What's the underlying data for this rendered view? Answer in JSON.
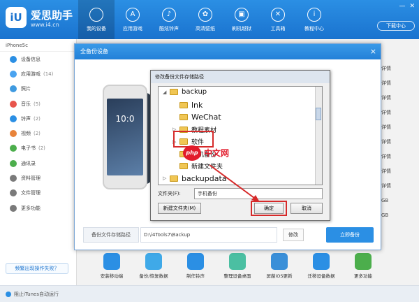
{
  "app": {
    "logo_text": "iU",
    "brand": "爱思助手",
    "url": "www.i4.cn",
    "download_center": "下载中心"
  },
  "nav": [
    {
      "label": "我的设备",
      "icon": "apple-icon"
    },
    {
      "label": "应用游戏",
      "icon": "appstore-icon"
    },
    {
      "label": "酷炫铃声",
      "icon": "bell-icon"
    },
    {
      "label": "高清壁纸",
      "icon": "flower-icon"
    },
    {
      "label": "刷机越狱",
      "icon": "box-icon"
    },
    {
      "label": "工具箱",
      "icon": "tools-icon"
    },
    {
      "label": "教程中心",
      "icon": "info-icon"
    }
  ],
  "sidebar": {
    "device": "iPhone5c",
    "items": [
      {
        "label": "设备信息",
        "count": "",
        "color": "#2b8fe4"
      },
      {
        "label": "应用游戏",
        "count": "(14)",
        "color": "#4aa3f0"
      },
      {
        "label": "照片",
        "count": "",
        "color": "#3f9ae0"
      },
      {
        "label": "音乐",
        "count": "(5)",
        "color": "#e8554c"
      },
      {
        "label": "铃声",
        "count": "(2)",
        "color": "#2b8fe4"
      },
      {
        "label": "视频",
        "count": "(2)",
        "color": "#e8833a"
      },
      {
        "label": "电子书",
        "count": "(2)",
        "color": "#4cae4c"
      },
      {
        "label": "通讯录",
        "count": "",
        "color": "#4cae4c"
      },
      {
        "label": "资料管理",
        "count": "",
        "color": "#7a7a7a"
      },
      {
        "label": "文件管理",
        "count": "",
        "color": "#7a7a7a"
      },
      {
        "label": "更多功能",
        "count": "",
        "color": "#7a7a7a"
      }
    ],
    "footer_button": "频繁出现操作失败？"
  },
  "right_strip": [
    "详情",
    "详情",
    "详情",
    "详情",
    "详情",
    "详情",
    "详情",
    "详情",
    "详情",
    "GB",
    "GB"
  ],
  "bottom_apps": [
    {
      "label": "安装移动端",
      "color": "#2b8fe4"
    },
    {
      "label": "备份/恢复数据",
      "color": "#3fa9e8"
    },
    {
      "label": "制作铃声",
      "color": "#2b8fe4"
    },
    {
      "label": "整理设备桌面",
      "color": "#4bbfa2"
    },
    {
      "label": "屏蔽iOS更新",
      "color": "#3a8fd8"
    },
    {
      "label": "迁移设备数据",
      "color": "#2b8fe4"
    },
    {
      "label": "更多功能",
      "color": "#4cae4c"
    }
  ],
  "statusbar": "阻止iTunes自动运行",
  "backup_dialog": {
    "title": "全备份设备",
    "phone_time": "10:0",
    "path_label": "备份文件存储路径",
    "path_value": "D:\\i4Tools7\\Backup",
    "change_button": "修改",
    "start_button": "立即备份"
  },
  "folder_dialog": {
    "title": "修改备份文件存储路径",
    "tree": [
      {
        "label": "backup",
        "level": 1,
        "toggle": "◢"
      },
      {
        "label": "lnk",
        "level": 2,
        "toggle": ""
      },
      {
        "label": "WeChat",
        "level": 2,
        "toggle": ""
      },
      {
        "label": "教程素材",
        "level": 2,
        "toggle": "▷"
      },
      {
        "label": "软件",
        "level": 2,
        "toggle": "▷"
      },
      {
        "label": "手机备份",
        "level": 2,
        "toggle": ""
      },
      {
        "label": "新建文件夹",
        "level": 2,
        "toggle": ""
      },
      {
        "label": "backupdata",
        "level": 1,
        "toggle": "▷"
      }
    ],
    "folder_label": "文件夹(F):",
    "folder_value": "手机备份",
    "new_folder_button": "新建文件夹(M)",
    "ok_button": "确定",
    "cancel_button": "取消"
  },
  "watermark": {
    "logo": "php",
    "text": "中文网"
  },
  "colors": {
    "accent": "#2b8fe4",
    "highlight": "#d62a2a"
  }
}
